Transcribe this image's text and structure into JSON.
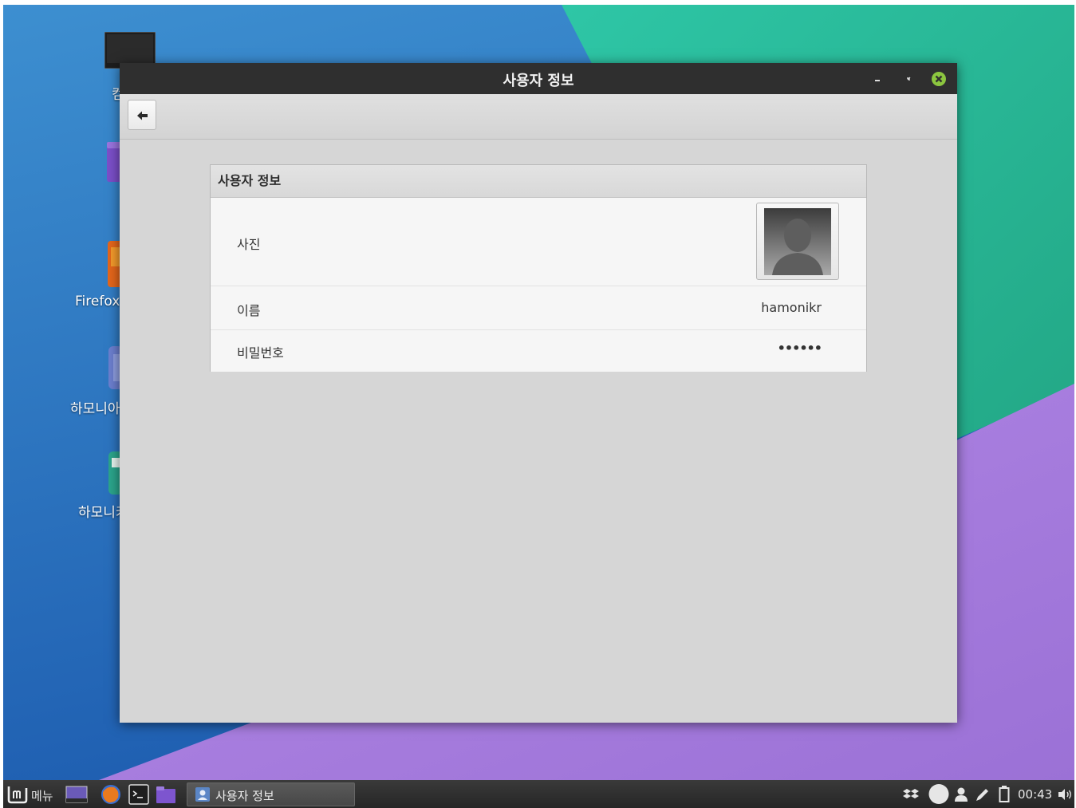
{
  "window": {
    "title": "사용자 정보",
    "panel_title": "사용자 정보",
    "rows": {
      "photo_label": "사진",
      "name_label": "이름",
      "name_value": "hamonikr",
      "password_label": "비밀번호",
      "password_value": "••••••"
    }
  },
  "desktop": {
    "icons": [
      {
        "label": "컴",
        "icon": "computer-icon"
      },
      {
        "label": "",
        "icon": "home-folder-icon"
      },
      {
        "label": "Firefox",
        "icon": "firefox-icon"
      },
      {
        "label": "하모니아",
        "icon": "hamonia-icon"
      },
      {
        "label": "하모니카",
        "icon": "hamonikr-icon"
      }
    ]
  },
  "taskbar": {
    "menu_label": "메뉴",
    "task_window_label": "사용자 정보",
    "clock": "00:43",
    "tray_icons": [
      "dropbox-icon",
      "network-icon",
      "user-icon",
      "pen-icon",
      "battery-icon",
      "volume-icon"
    ]
  },
  "colors": {
    "wallpaper_blue": "#2f82c8",
    "wallpaper_teal": "#2dbf9e",
    "wallpaper_purple": "#a77ee0",
    "titlebar": "#2f2f2f",
    "close_button": "#8cc63f"
  }
}
